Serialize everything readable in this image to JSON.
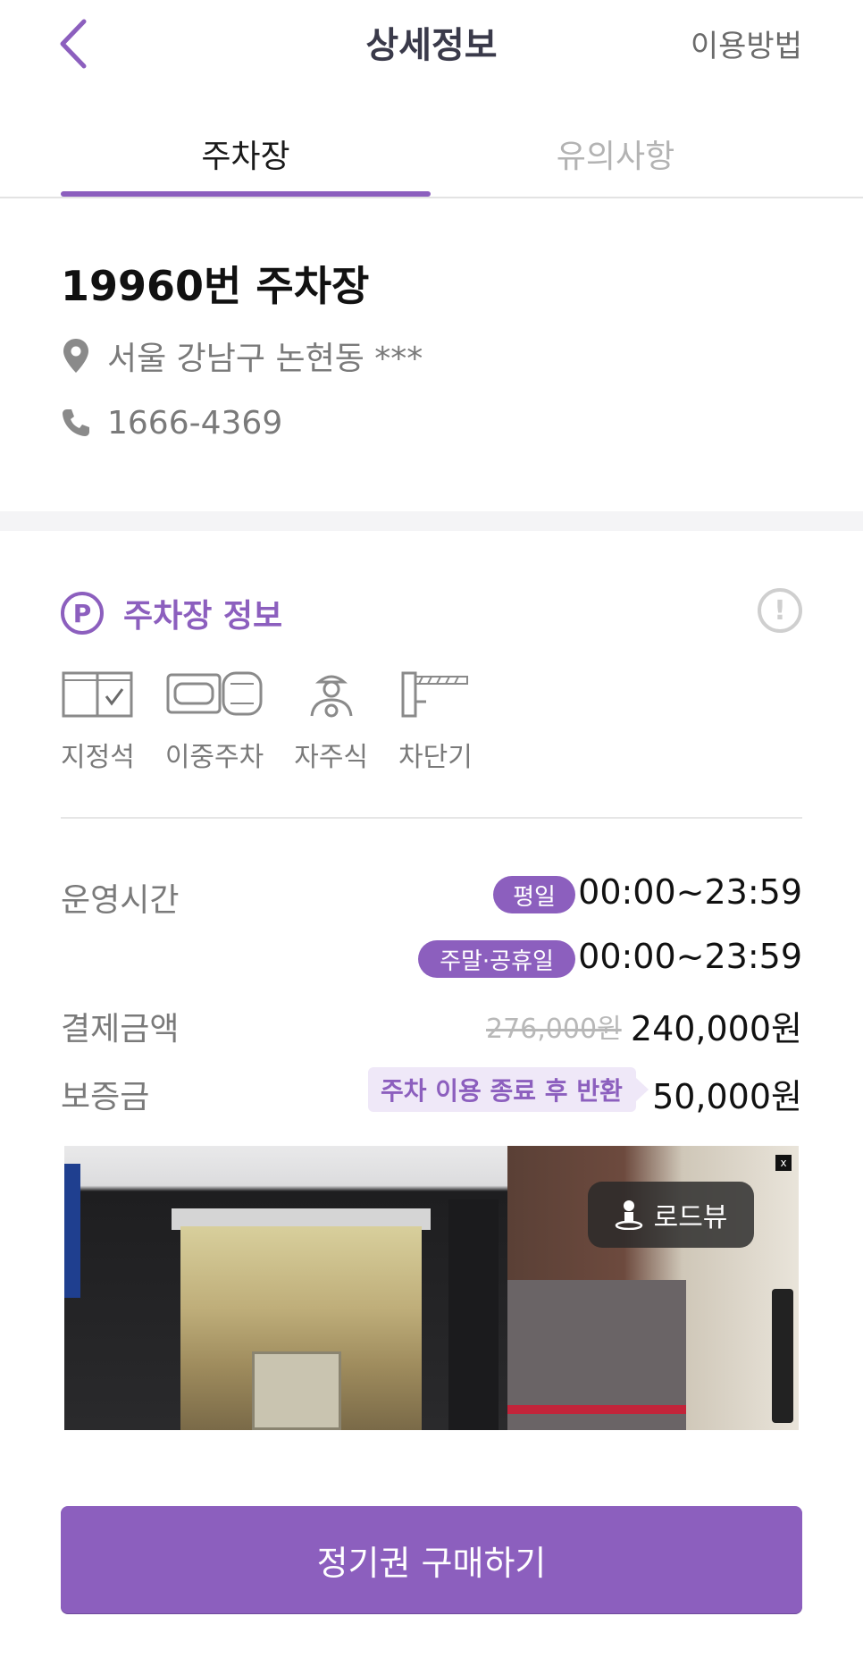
{
  "header": {
    "title": "상세정보",
    "help_link": "이용방법"
  },
  "tabs": [
    {
      "label": "주차장",
      "active": true
    },
    {
      "label": "유의사항",
      "active": false
    }
  ],
  "lot": {
    "name": "19960번 주차장",
    "address": "서울 강남구 논현동 ***",
    "phone": "1666-4369"
  },
  "section": {
    "badge": "P",
    "title": "주차장 정보",
    "info_icon": "!"
  },
  "features": [
    {
      "label": "지정석",
      "icon": "reserved-seat-icon"
    },
    {
      "label": "이중주차",
      "icon": "double-parking-icon"
    },
    {
      "label": "자주식",
      "icon": "self-park-icon"
    },
    {
      "label": "차단기",
      "icon": "barrier-gate-icon"
    }
  ],
  "details": {
    "hours_label": "운영시간",
    "weekday_pill": "평일",
    "weekday_hours": "00:00~23:59",
    "weekend_pill": "주말·공휴일",
    "weekend_hours": "00:00~23:59",
    "price_label": "결제금액",
    "original_price": "276,000원",
    "price": "240,000원",
    "deposit_label": "보증금",
    "deposit_note": "주차 이용 종료 후 반환",
    "deposit": "50,000원"
  },
  "roadview": {
    "badge_label": "로드뷰",
    "close_label": "x"
  },
  "cta": {
    "label": "정기권 구매하기"
  },
  "colors": {
    "accent": "#8c5fbe",
    "accent_light": "#efe8f8"
  }
}
